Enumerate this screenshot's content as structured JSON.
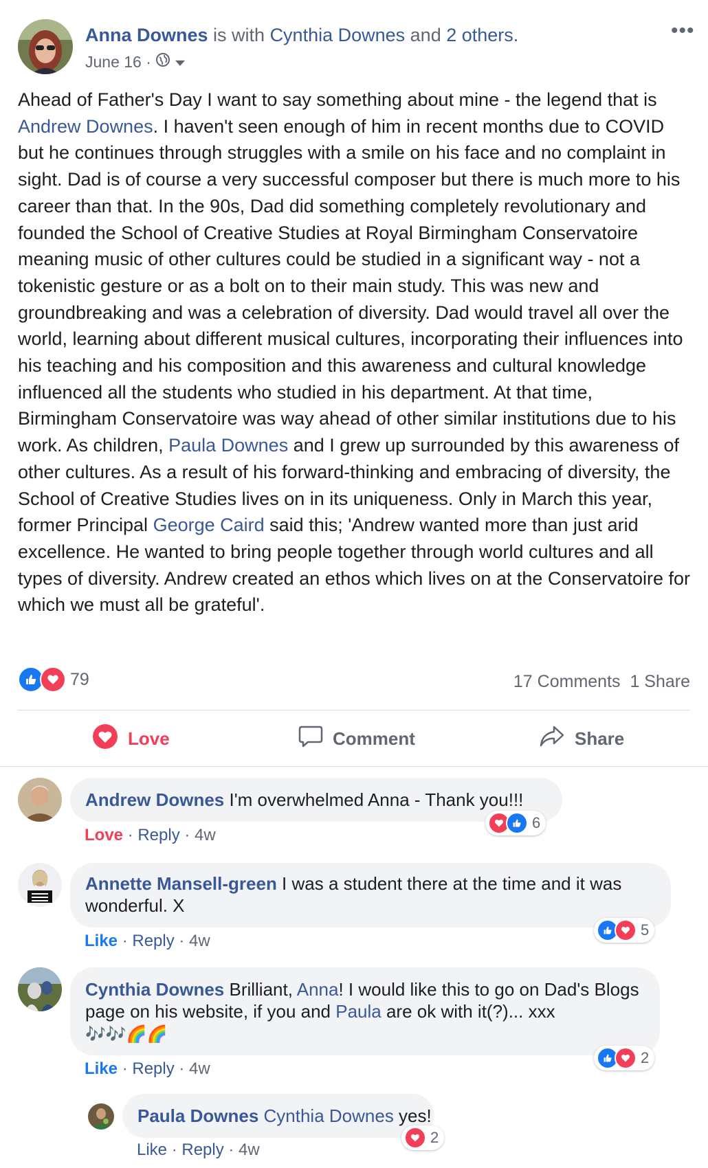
{
  "post": {
    "author": "Anna Downes",
    "with_text": " is with ",
    "tagged": "Cynthia Downes",
    "and_text": " and ",
    "others": "2 others.",
    "date": "June 16 ·",
    "text_segments": [
      "Ahead of Father's Day I want to say something about mine - the legend that is ",
      "Andrew Downes",
      ". I haven't seen enough of him in recent months due to COVID but he continues through struggles with a smile on his face and no complaint in sight. Dad is of course a very successful composer but there is much more to his career than that. In the 90s, Dad did something completely revolutionary and founded the School of Creative Studies at Royal Birmingham Conservatoire meaning music of other cultures could be studied in a significant way - not a tokenistic gesture or as a bolt on to their main study. This was new and groundbreaking and was a celebration of diversity. Dad would travel all over the world, learning about different musical cultures, incorporating their influences into his teaching and his composition and this awareness and cultural knowledge influenced all the students who studied in his department. At that time, Birmingham Conservatoire was way ahead of other similar institutions due to his work. As children, ",
      "Paula Downes",
      " and I grew up surrounded by this awareness of other cultures. As a result of his forward-thinking and embracing of diversity, the School of Creative Studies lives on in its uniqueness. Only in March this year, former Principal ",
      "George Caird",
      " said this; 'Andrew wanted more than just arid excellence. He wanted to bring people together through world cultures and all types of diversity. Andrew created an ethos which lives on at the Conservatoire for which we must all be grateful'."
    ],
    "reaction_count": "79",
    "comments_count": "17 Comments",
    "shares_count": "1 Share"
  },
  "actions": {
    "love": "Love",
    "comment": "Comment",
    "share": "Share"
  },
  "comments": [
    {
      "author": "Andrew Downes",
      "text": " I'm overwhelmed Anna - Thank you!!!",
      "reaction_label": "Love",
      "reply": "Reply",
      "time": "· 4w",
      "reaction_count": "6"
    },
    {
      "author": "Annette Mansell-green",
      "text": " I was a student there at the time and it was wonderful. X",
      "reaction_label": "Like",
      "reply": "Reply",
      "time": "· 4w",
      "reaction_count": "5"
    },
    {
      "author": "Cynthia Downes",
      "text_a": " Brilliant, ",
      "mention_a": "Anna",
      "text_b": "! I would like this to go on Dad's Blogs page on his website, if you and ",
      "mention_b": "Paula",
      "text_c": " are ok with it(?)... xxx",
      "emoji": "🎶🎶🌈🌈",
      "reaction_label": "Like",
      "reply": "Reply",
      "time": "· 4w",
      "reaction_count": "2"
    },
    {
      "author": "Paula Downes",
      "mention": "Cynthia Downes",
      "text": " yes!",
      "reaction_label": "Like",
      "reply": "Reply",
      "time": "· 4w",
      "reaction_count": "2"
    }
  ],
  "colors": {
    "link": "#385898",
    "love": "#f33e58",
    "like": "#1877f2",
    "muted": "#606770"
  }
}
